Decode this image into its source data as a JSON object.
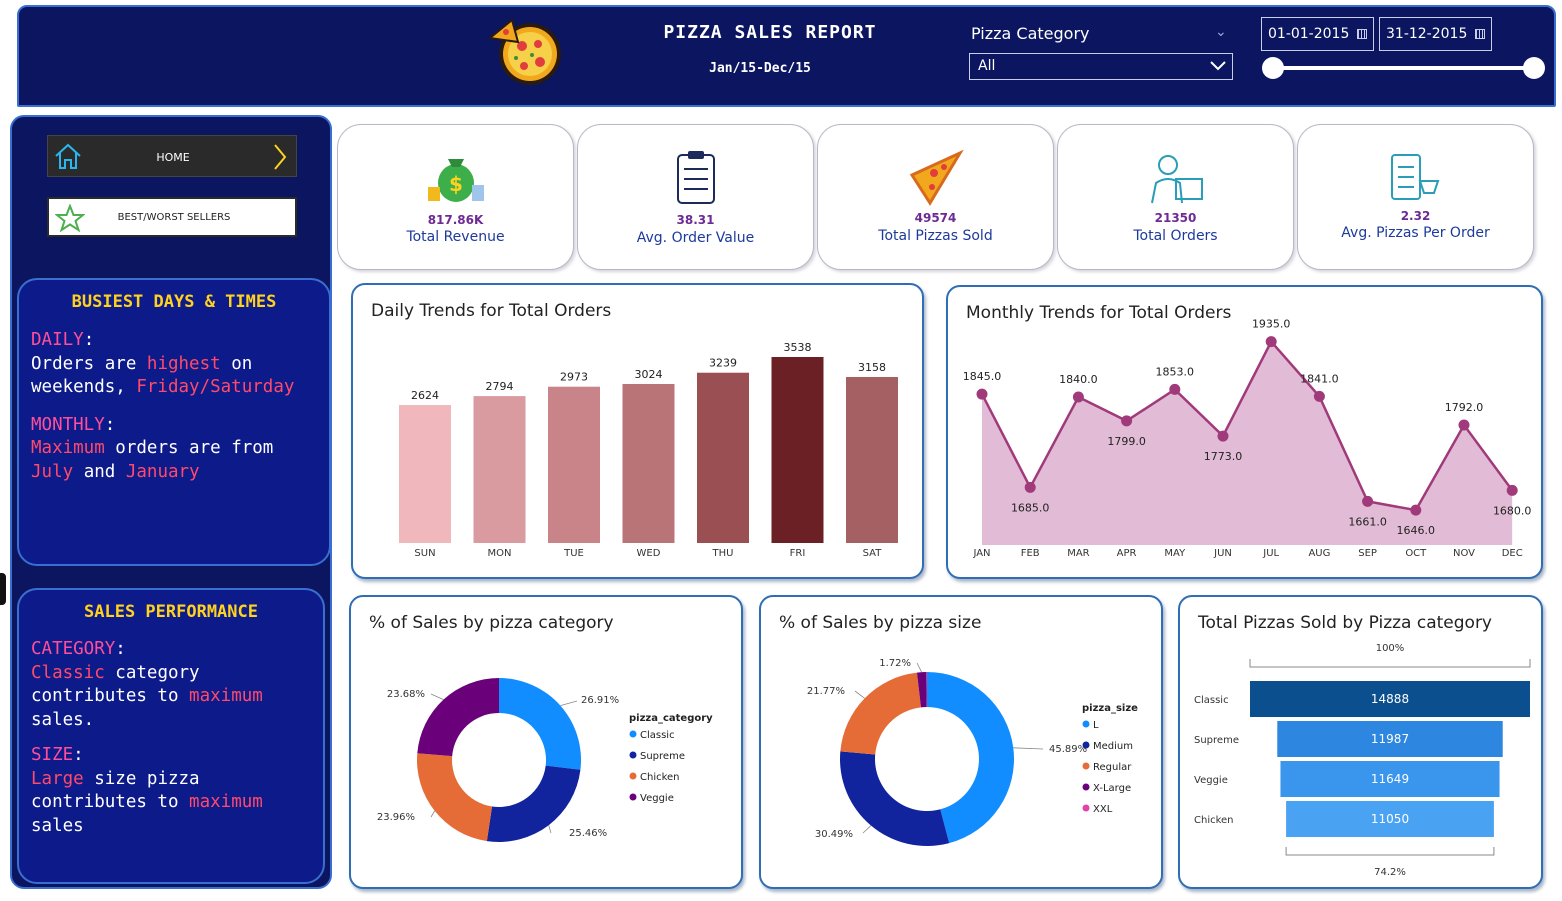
{
  "header": {
    "title": "PIZZA SALES REPORT",
    "subtitle": "Jan/15-Dec/15",
    "category_label": "Pizza Category",
    "category_value": "All",
    "date_start": "01-01-2015",
    "date_end": "31-12-2015",
    "date_range_selected": [
      0,
      1
    ]
  },
  "nav": {
    "home": "HOME",
    "best_worst": "BEST/WORST SELLERS"
  },
  "busiest": {
    "title": "BUSIEST DAYS & TIMES",
    "daily_label": "DAILY",
    "daily_t1": "Orders are ",
    "daily_hl1": "highest",
    "daily_t2": " on",
    "daily_t3": "weekends, ",
    "daily_hl2": "Friday/Saturday",
    "monthly_label": "MONTHLY",
    "monthly_hl1": "Maximum",
    "monthly_t1": " orders are from",
    "monthly_hl2": "July",
    "monthly_t2": " and ",
    "monthly_hl3": "January"
  },
  "performance": {
    "title": "SALES PERFORMANCE",
    "category_label": "CATEGORY",
    "cat_hl1": "Classic",
    "cat_t1": " category",
    "cat_t2": "contributes to ",
    "cat_hl2": "maximum",
    "cat_t3": "sales.",
    "size_label": "SIZE",
    "size_hl1": "Large",
    "size_t1": " size pizza",
    "size_t2": "contributes to ",
    "size_hl2": "maximum",
    "size_t3": "sales"
  },
  "kpis": [
    {
      "value": "817.86K",
      "label": "Total Revenue"
    },
    {
      "value": "38.31",
      "label": "Avg. Order Value"
    },
    {
      "value": "49574",
      "label": "Total Pizzas Sold"
    },
    {
      "value": "21350",
      "label": "Total Orders"
    },
    {
      "value": "2.32",
      "label": "Avg. Pizzas Per Order"
    }
  ],
  "colors": {
    "navy": "#0b1560",
    "accent_blue": "#3a6fd1",
    "highlight_pink": "#ff4f9a",
    "highlight_yellow": "#ffd21f",
    "monthly_line": "#a03a7a",
    "monthly_area": "#e2bcd6"
  },
  "chart_data": [
    {
      "type": "bar",
      "title": "Daily Trends for Total Orders",
      "categories": [
        "SUN",
        "MON",
        "TUE",
        "WED",
        "THU",
        "FRI",
        "SAT"
      ],
      "values": [
        2624,
        2794,
        2973,
        3024,
        3239,
        3538,
        3158
      ],
      "colors": [
        "#f0b8bd",
        "#d99aa0",
        "#c88488",
        "#b87477",
        "#9a4f53",
        "#6b2026",
        "#a56064"
      ]
    },
    {
      "type": "area",
      "title": "Monthly Trends for Total Orders",
      "categories": [
        "JAN",
        "FEB",
        "MAR",
        "APR",
        "MAY",
        "JUN",
        "JUL",
        "AUG",
        "SEP",
        "OCT",
        "NOV",
        "DEC"
      ],
      "values": [
        1845.0,
        1685.0,
        1840.0,
        1799.0,
        1853.0,
        1773.0,
        1935.0,
        1841.0,
        1661.0,
        1646.0,
        1792.0,
        1680.0
      ],
      "labels": [
        "1845.0",
        "1685.0",
        "1840.0",
        "1799.0",
        "1853.0",
        "1773.0",
        "1935.0",
        "1841.0",
        "1661.0",
        "1646.0",
        "1792.0",
        "1680.0"
      ]
    },
    {
      "type": "pie",
      "title": "% of Sales by pizza category",
      "legend_title": "pizza_category",
      "categories": [
        "Classic",
        "Supreme",
        "Chicken",
        "Veggie"
      ],
      "values": [
        26.91,
        25.46,
        23.96,
        23.68
      ],
      "labels": [
        "26.91%",
        "25.46%",
        "23.96%",
        "23.68%"
      ],
      "colors": [
        "#118dff",
        "#12239e",
        "#e66c37",
        "#6b007b"
      ]
    },
    {
      "type": "pie",
      "title": "% of Sales by pizza size",
      "legend_title": "pizza_size",
      "categories": [
        "L",
        "Medium",
        "Regular",
        "X-Large",
        "XXL"
      ],
      "values": [
        45.89,
        30.49,
        21.77,
        1.72,
        0.12
      ],
      "labels": [
        "45.89%",
        "30.49%",
        "21.77%",
        "1.72%",
        ""
      ],
      "colors": [
        "#118dff",
        "#12239e",
        "#e66c37",
        "#6b007b",
        "#e044a7"
      ]
    },
    {
      "type": "bar",
      "title": "Total Pizzas Sold by Pizza category",
      "categories": [
        "Classic",
        "Supreme",
        "Veggie",
        "Chicken"
      ],
      "values": [
        14888,
        11987,
        11649,
        11050
      ],
      "top_label": "100%",
      "bottom_label": "74.2%",
      "colors": [
        "#0b4f8f",
        "#2d87e0",
        "#3a95ec",
        "#4aa3f2"
      ]
    }
  ]
}
